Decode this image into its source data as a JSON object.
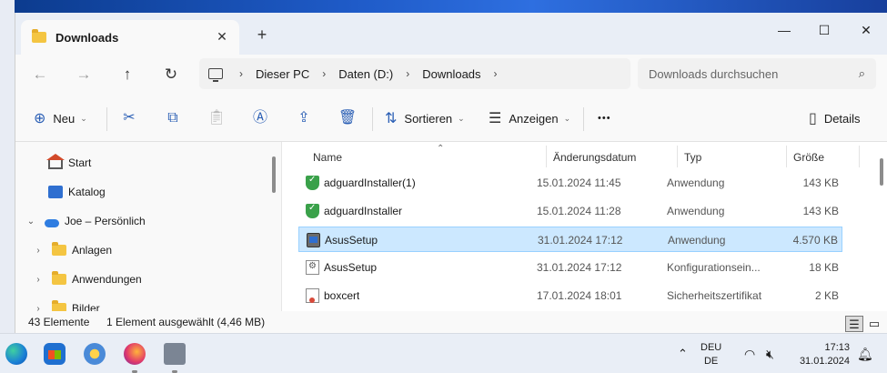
{
  "tab": {
    "title": "Downloads",
    "close": "✕",
    "new": "+"
  },
  "window_controls": {
    "minimize": "—",
    "maximize": "☐",
    "close": "✕"
  },
  "nav": {
    "back": "←",
    "forward": "→",
    "up": "↑",
    "refresh": "↻"
  },
  "address": {
    "segments": [
      "Dieser PC",
      "Daten (D:)",
      "Downloads"
    ],
    "separator": "›"
  },
  "search": {
    "placeholder": "Downloads durchsuchen",
    "icon": "⌕"
  },
  "commands": {
    "new_label": "Neu",
    "sort_label": "Sortieren",
    "view_label": "Anzeigen",
    "more": "•••",
    "details_label": "Details"
  },
  "sidebar": {
    "items": [
      {
        "label": "Start",
        "icon": "home-icon"
      },
      {
        "label": "Katalog",
        "icon": "gallery-icon"
      },
      {
        "label": "Joe – Persönlich",
        "icon": "onedrive-icon"
      },
      {
        "label": "Anlagen",
        "icon": "folder-icon"
      },
      {
        "label": "Anwendungen",
        "icon": "folder-icon"
      },
      {
        "label": "Bilder",
        "icon": "folder-icon"
      }
    ]
  },
  "columns": {
    "name": "Name",
    "date": "Änderungsdatum",
    "type": "Typ",
    "size": "Größe"
  },
  "files": [
    {
      "name": "adguardInstaller(1)",
      "date": "15.01.2024 11:45",
      "type": "Anwendung",
      "size": "143 KB",
      "icon": "shield-icon"
    },
    {
      "name": "adguardInstaller",
      "date": "15.01.2024 11:28",
      "type": "Anwendung",
      "size": "143 KB",
      "icon": "shield-icon"
    },
    {
      "name": "AsusSetup",
      "date": "31.01.2024 17:12",
      "type": "Anwendung",
      "size": "4.570 KB",
      "icon": "setup-icon",
      "selected": true
    },
    {
      "name": "AsusSetup",
      "date": "31.01.2024 17:12",
      "type": "Konfigurationsein...",
      "size": "18 KB",
      "icon": "config-icon"
    },
    {
      "name": "boxcert",
      "date": "17.01.2024 18:01",
      "type": "Sicherheitszertifikat",
      "size": "2 KB",
      "icon": "certificate-icon"
    }
  ],
  "status": {
    "count": "43 Elemente",
    "selection": "1 Element ausgewählt (4,46 MB)"
  },
  "taskbar": {
    "lang_line1": "DEU",
    "lang_line2": "DE",
    "time": "17:13",
    "date": "31.01.2024"
  }
}
